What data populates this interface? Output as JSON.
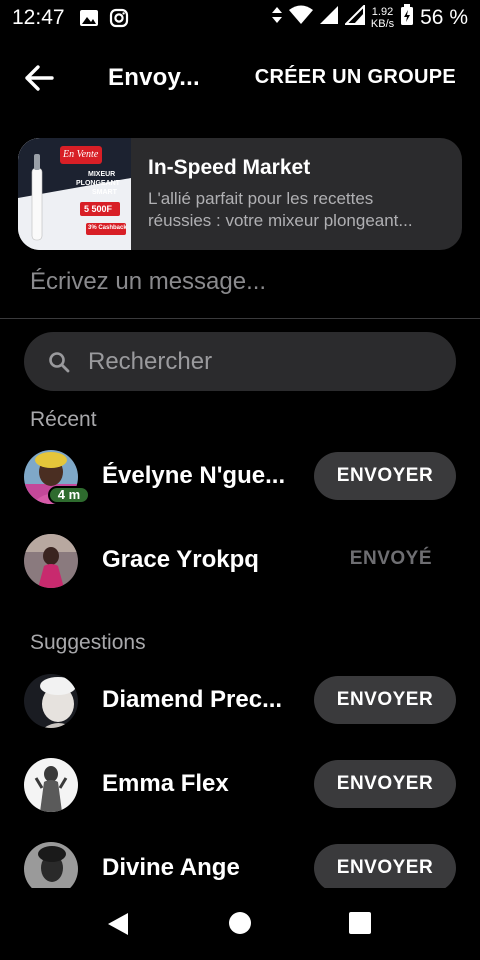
{
  "status_bar": {
    "time": "12:47",
    "speed_value": "1.92",
    "speed_unit": "KB/s",
    "battery": "56 %"
  },
  "header": {
    "title": "Envoy...",
    "create_group": "CRÉER UN GROUPE"
  },
  "shared_item": {
    "title": "In-Speed Market",
    "desc_line1": "L'allié parfait pour les recettes",
    "desc_line2": "réussies : votre mixeur plongeant...",
    "thumb_text": {
      "tag": "En Vente",
      "product_line1": "MIXEUR",
      "product_line2": "PLONGEANT",
      "product_line3": "SMART",
      "price": "5 500F",
      "cashback": "3% Cashback"
    }
  },
  "message_placeholder": "Écrivez un message...",
  "search": {
    "placeholder": "Rechercher"
  },
  "sections": {
    "recent": "Récent",
    "suggestions": "Suggestions"
  },
  "recent": [
    {
      "name": "Évelyne N'gue...",
      "badge": "4 m",
      "action": "ENVOYER"
    },
    {
      "name": "Grace Yrokpq",
      "status": "ENVOYÉ"
    }
  ],
  "suggestions": [
    {
      "name": "Diamend Prec...",
      "action": "ENVOYER"
    },
    {
      "name": "Emma Flex",
      "action": "ENVOYER"
    },
    {
      "name": "Divine Ange",
      "action": "ENVOYER"
    }
  ],
  "colors": {
    "background": "#000000",
    "card": "#2b2b2d",
    "button": "#3a3a3c",
    "badge_green": "#2e6b2e"
  }
}
